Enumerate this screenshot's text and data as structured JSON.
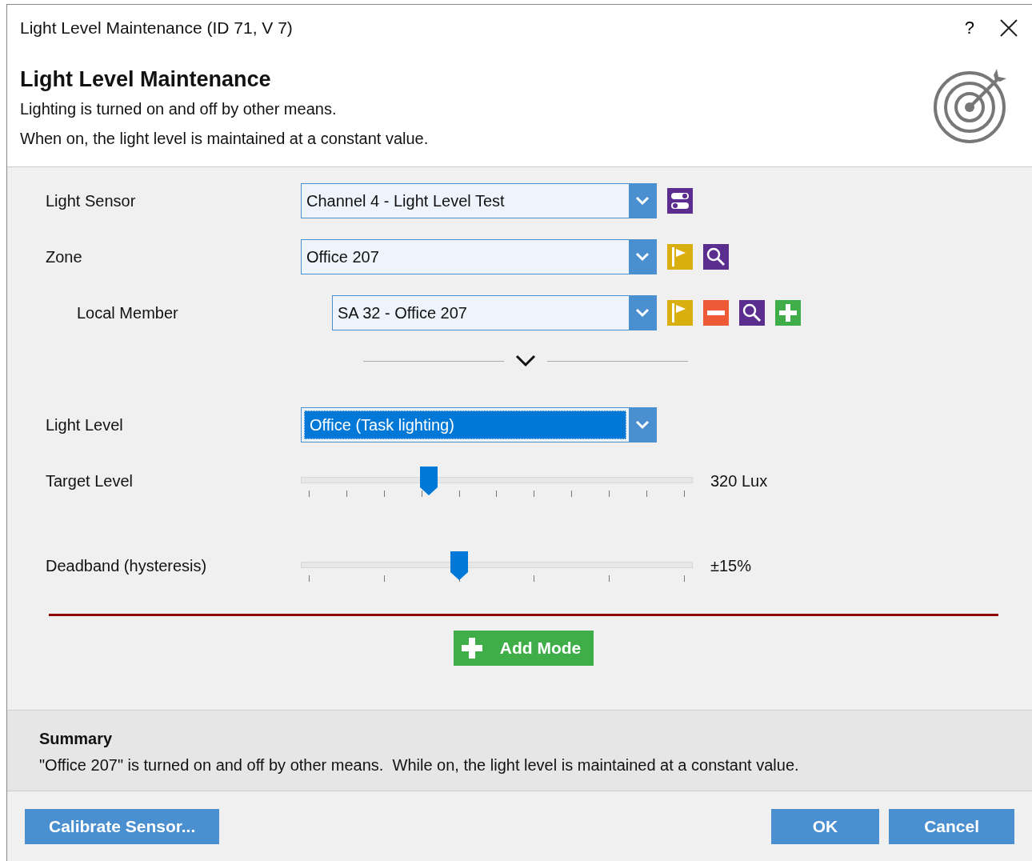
{
  "window": {
    "title": "Light Level Maintenance (ID 71, V 7)",
    "help": "?"
  },
  "header": {
    "title": "Light Level Maintenance",
    "lines": [
      "Lighting is turned on and off by other means.",
      "When on, the light level is maintained at a constant value."
    ]
  },
  "rows": [
    {
      "kind": "select",
      "label": "Light Sensor",
      "value": "Channel 4 - Light Level Test",
      "indent": false,
      "highlighted": false,
      "actions": [
        {
          "kind": "settings"
        }
      ]
    },
    {
      "kind": "select",
      "label": "Zone",
      "value": "Office 207",
      "indent": false,
      "highlighted": false,
      "actions": [
        {
          "kind": "flag"
        },
        {
          "kind": "search"
        }
      ]
    },
    {
      "kind": "select",
      "label": "Local Member",
      "value": "SA 32 - Office 207",
      "indent": true,
      "highlighted": false,
      "actions": [
        {
          "kind": "flag"
        },
        {
          "kind": "remove"
        },
        {
          "kind": "search"
        },
        {
          "kind": "add"
        }
      ]
    },
    {
      "kind": "expander",
      "expanded": false
    },
    {
      "kind": "select",
      "label": "Light Level",
      "value": "Office (Task lighting)",
      "indent": false,
      "highlighted": true,
      "actions": []
    },
    {
      "kind": "slider",
      "label": "Target Level",
      "level": 0.32,
      "reading": "320 Lux"
    },
    {
      "kind": "slider",
      "label": "Deadband (hysteresis)",
      "level": 0.4,
      "reading": "±15%"
    }
  ],
  "add_button": "Add Mode",
  "summary": {
    "title": "Summary",
    "text": "\"Office 207\" is turned on and off by other means.  While on, the light level is maintained at a constant value."
  },
  "footer": {
    "left": "Calibrate Sensor...",
    "buttons": [
      "OK",
      "Cancel"
    ]
  }
}
